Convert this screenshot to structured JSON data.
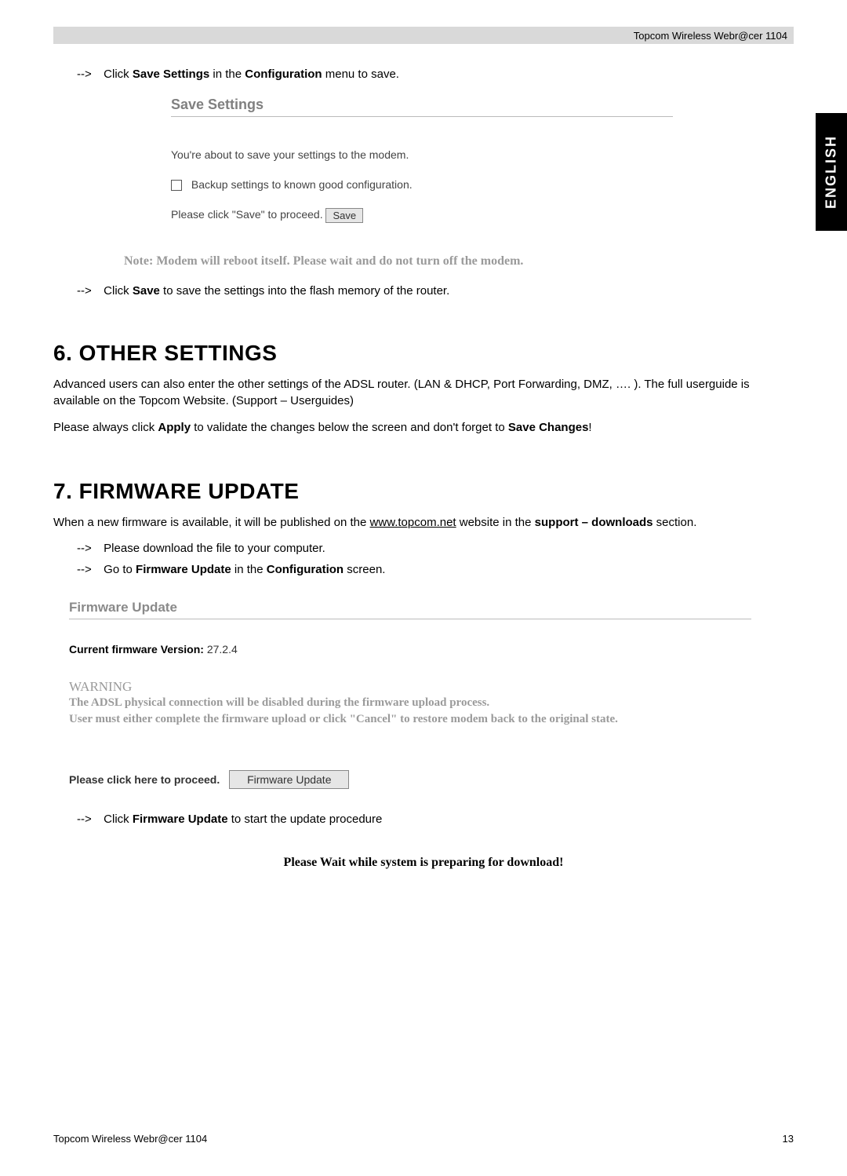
{
  "header": {
    "text": "Topcom Wireless Webr@cer 1104"
  },
  "side_tab": "ENGLISH",
  "instr1": {
    "arrow": "-->",
    "pre": "Click ",
    "b1": "Save Settings",
    "mid": " in the ",
    "b2": "Configuration",
    "post": " menu to save."
  },
  "ss1": {
    "title": "Save Settings",
    "line1": "You're about to save your settings to the modem.",
    "line2": "Backup settings to known good configuration.",
    "line3": "Please click \"Save\" to proceed.",
    "save_btn": "Save"
  },
  "note": "Note: Modem will reboot itself. Please wait and do not turn off the modem.",
  "instr2": {
    "arrow": "-->",
    "pre": "Click ",
    "b1": "Save",
    "post": " to save the settings into the flash memory of the router."
  },
  "sec6": {
    "heading": "6. OTHER SETTINGS",
    "p1": "Advanced users can also enter the other settings of the ADSL router. (LAN & DHCP, Port Forwarding, DMZ, …. ). The full userguide is available on the Topcom Website. (Support – Userguides)",
    "p2_pre": "Please always click ",
    "p2_b1": "Apply",
    "p2_mid": " to validate the changes below the screen and don't forget to ",
    "p2_b2": "Save Changes",
    "p2_post": "!"
  },
  "sec7": {
    "heading": "7. FIRMWARE UPDATE",
    "p_pre": "When a new firmware is available, it will be published on the ",
    "p_link": "www.topcom.net",
    "p_mid": " website in the ",
    "p_b": "support – downloads",
    "p_post": " section.",
    "b1_arrow": "-->",
    "b1_text": "Please download the file to your computer.",
    "b2_arrow": "-->",
    "b2_pre": "Go to ",
    "b2_b1": "Firmware Update",
    "b2_mid": " in the ",
    "b2_b2": "Configuration",
    "b2_post": " screen."
  },
  "ss2": {
    "title": "Firmware Update",
    "ver_label": "Current firmware Version:",
    "ver_val": " 27.2.4",
    "warn_head": "WARNING",
    "warn_line1": "The ADSL physical connection will be disabled during the firmware upload process.",
    "warn_line2": "User must either complete the firmware upload or click \"Cancel\" to restore modem back to the original state.",
    "proceed_label": "Please click here to proceed.",
    "fw_btn": "Firmware Update"
  },
  "instr3": {
    "arrow": "-->",
    "pre": "Click ",
    "b1": "Firmware Update",
    "post": " to start the update procedure"
  },
  "wait_msg": "Please Wait while system is preparing for download!",
  "footer": {
    "left": "Topcom Wireless Webr@cer 1104",
    "page": "13"
  }
}
